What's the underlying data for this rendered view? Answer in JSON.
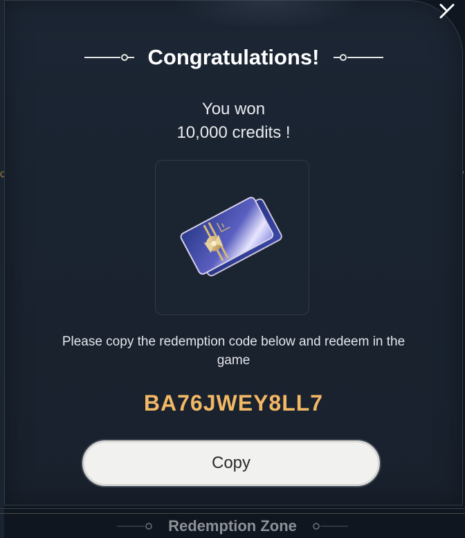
{
  "modal": {
    "title": "Congratulations!",
    "won_line1": "You won",
    "won_line2": "10,000 credits !",
    "instructions": "Please copy the redemption code below and redeem in the game",
    "code": "BA76JWEY8LL7",
    "copy_label": "Copy",
    "close_icon": "close-icon",
    "prize_icon": "credits-ticket-icon"
  },
  "background": {
    "footer_title": "Redemption Zone",
    "right_mark": "w",
    "left_mark": "C"
  },
  "colors": {
    "code": "#f2b865",
    "modal_bg": "#1a2330",
    "button_bg": "#f1f1ef"
  }
}
